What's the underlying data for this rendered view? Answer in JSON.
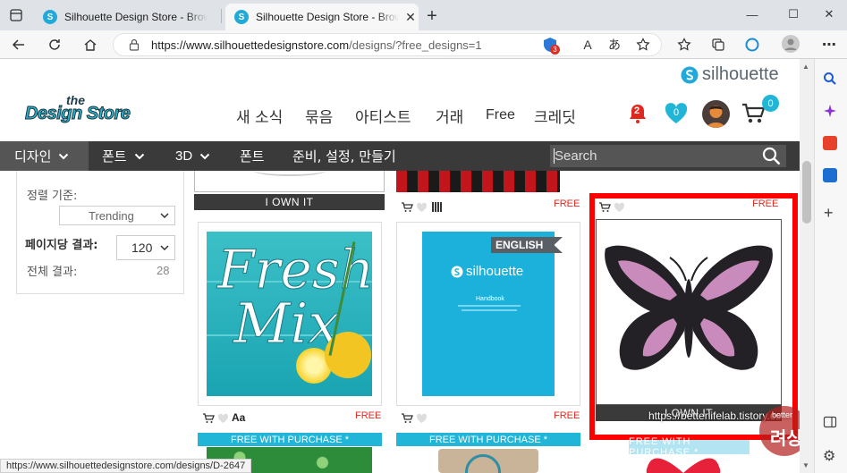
{
  "browser": {
    "tabs": [
      {
        "title": "Silhouette Design Store - Browse",
        "active": false
      },
      {
        "title": "Silhouette Design Store - Browse",
        "active": true
      }
    ],
    "new_tab": "+",
    "window": {
      "minimize": "—",
      "maximize": "☐",
      "close": "✕"
    },
    "address": "https://www.silhouettedesignstore.com/designs/?free_designs=1",
    "address_host": "https://www.silhouettedesignstore.com",
    "address_rest": "/designs/?free_designs=1",
    "ext_badge": "3",
    "read_aloud": "A",
    "translate": "あ"
  },
  "site": {
    "brand_small": "silhouette",
    "logo": {
      "line1": "the",
      "line2": "Design Store"
    },
    "menu": [
      "새 소식",
      "묶음",
      "아티스트",
      "거래",
      "Free",
      "크레딧"
    ],
    "notification_count": "2",
    "wishlist_count": "0",
    "cart_count": "0",
    "nav": [
      {
        "label": "디자인",
        "has_dropdown": true
      },
      {
        "label": "폰트",
        "has_dropdown": true
      },
      {
        "label": "3D",
        "has_dropdown": true
      },
      {
        "label": "폰트",
        "has_dropdown": false
      },
      {
        "label": "준비, 설정, 만들기",
        "has_dropdown": false
      }
    ],
    "search_placeholder": "Search"
  },
  "filters": {
    "sort_label": "정렬 기준:",
    "sort_value": "Trending",
    "per_page_label": "페이지당 결과:",
    "per_page_value": "120",
    "total_label": "전체 결과:",
    "total_value": "28"
  },
  "products": {
    "own_it": "I OWN IT",
    "free": "FREE",
    "font_badge": "Aa",
    "english_badge": "ENGLISH",
    "handbook_brand": "silhouette",
    "handbook_title": "Handbook",
    "fresh_mix_line1": "Fresh",
    "fresh_mix_line2": "Mix",
    "free_with_purchase": "FREE WITH PURCHASE *"
  },
  "status_url": "https://www.silhouettedesignstore.com/designs/D-2647",
  "watermark": {
    "url": "https://betterlifelab.tistory.com",
    "badge_top": "better",
    "badge_main": "려상"
  },
  "colors": {
    "accent": "#21b5d8",
    "nav_bg": "#3a3a3a",
    "free": "#e0281f",
    "highlight": "#ff0000"
  }
}
